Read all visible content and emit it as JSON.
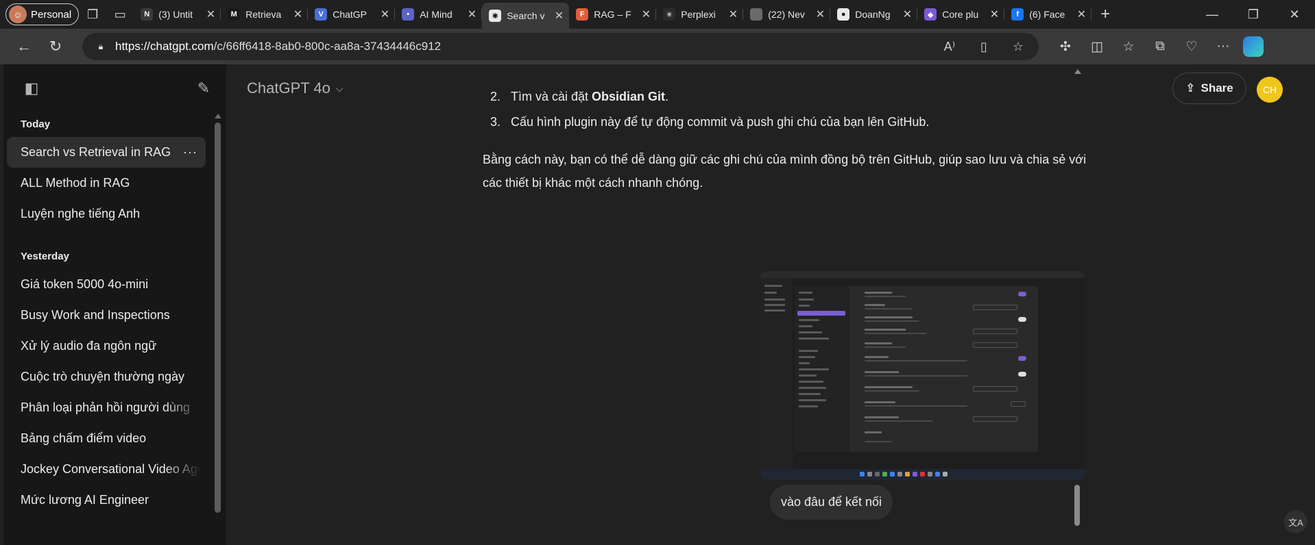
{
  "browser": {
    "profile_label": "Personal",
    "tabs": [
      {
        "title": "(3) Untit",
        "favicon": "notion-icon",
        "color": "#3a3a3a",
        "glyph": "N"
      },
      {
        "title": "Retrieva",
        "favicon": "medium-icon",
        "color": "#1a1a1a",
        "glyph": "M"
      },
      {
        "title": "ChatGP",
        "favicon": "vercel-icon",
        "color": "#4a6fd8",
        "glyph": "V"
      },
      {
        "title": "AI Mind",
        "favicon": "ai-mind-icon",
        "color": "#5c63c9",
        "glyph": "•"
      },
      {
        "title": "Search v",
        "favicon": "chatgpt-icon",
        "color": "#e8e8e8",
        "glyph": "✺"
      },
      {
        "title": "RAG – F",
        "favicon": "figma-icon",
        "color": "#e35d3a",
        "glyph": "F"
      },
      {
        "title": "Perplexi",
        "favicon": "perplexity-icon",
        "color": "#2b2b2b",
        "glyph": "✳"
      },
      {
        "title": "(22) Nev",
        "favicon": "blank-tab-icon",
        "color": "#6b6b6b",
        "glyph": ""
      },
      {
        "title": "DoanNg",
        "favicon": "github-icon",
        "color": "#e8e8e8",
        "glyph": "●"
      },
      {
        "title": "Core plu",
        "favicon": "obsidian-icon",
        "color": "#7d5ad6",
        "glyph": "◆"
      },
      {
        "title": "(6) Face",
        "favicon": "facebook-icon",
        "color": "#1877f2",
        "glyph": "f"
      }
    ],
    "active_tab_index": 4,
    "url_host": "https://chatgpt.com",
    "url_path": "/c/66ff6418-8ab0-800c-aa8a-37434446c912"
  },
  "sidebar": {
    "sections": [
      {
        "title": "Today",
        "items": [
          {
            "label": "Search vs Retrieval in RAG",
            "active": true
          },
          {
            "label": "ALL Method in RAG"
          },
          {
            "label": "Luyện nghe tiếng Anh"
          }
        ]
      },
      {
        "title": "Yesterday",
        "items": [
          {
            "label": "Giá token 5000 4o-mini"
          },
          {
            "label": "Busy Work and Inspections"
          },
          {
            "label": "Xử lý audio đa ngôn ngữ"
          },
          {
            "label": "Cuộc trò chuyện thường ngày"
          },
          {
            "label": "Phân loại phản hồi người dùng"
          },
          {
            "label": "Bảng chấm điểm video"
          },
          {
            "label": "Jockey Conversational Video Age"
          },
          {
            "label": "Mức lương AI Engineer"
          }
        ]
      }
    ],
    "item_more": "···"
  },
  "header": {
    "model_label": "ChatGPT 4o",
    "share_label": "Share",
    "user_initials": "CH",
    "user_color": "#f0c51c"
  },
  "conversation": {
    "list_items": [
      {
        "num": "2.",
        "prefix": "Tìm và cài đặt ",
        "bold": "Obsidian Git",
        "suffix": "."
      },
      {
        "num": "3.",
        "prefix": "Cấu hình plugin này để tự động commit và push ghi chú của bạn lên GitHub.",
        "bold": "",
        "suffix": ""
      }
    ],
    "paragraph": "Bằng cách này, bạn có thể dễ dàng giữ các ghi chú của mình đồng bộ trên GitHub, giúp sao lưu và chia sẻ với các thiết bị khác một cách nhanh chóng.",
    "user_message": "vào đâu để kết nối"
  },
  "colors": {
    "accent_purple": "#7b5cd6",
    "sidebar_bg": "#171717",
    "main_bg": "#212121"
  }
}
